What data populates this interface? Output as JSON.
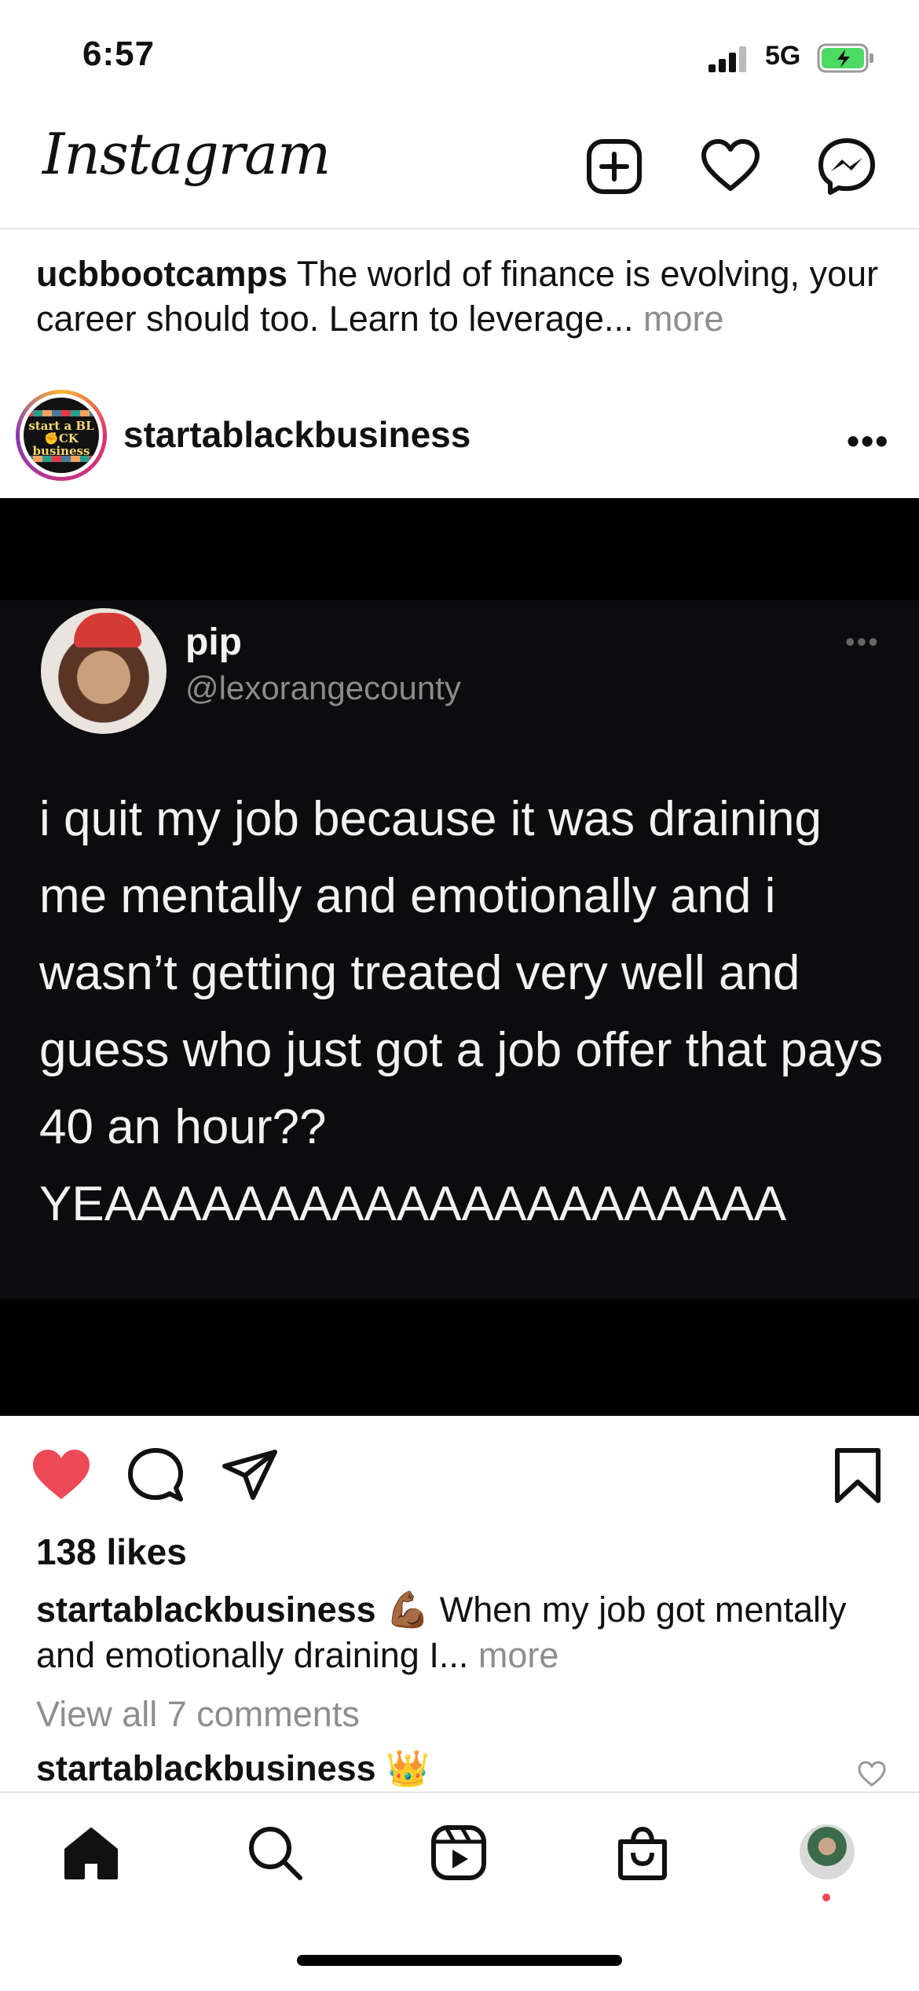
{
  "status_bar": {
    "time": "6:57",
    "network": "5G"
  },
  "header": {
    "logo": "Instagram"
  },
  "previous_post": {
    "username": "ucbbootcamps",
    "caption": " The world of finance is evolving, your career should too. Learn to leverage...",
    "more": " more"
  },
  "post": {
    "avatar_text": "start a BL✊CK business",
    "username": "startablackbusiness",
    "more": "•••",
    "tweet": {
      "name": "pip",
      "handle": "@lexorangecounty",
      "text": "i quit my job because it was draining me mentally and emotionally and i wasn’t getting treated very well and guess who just got a job offer that pays 40 an hour?? YEAAAAAAAAAAAAAAAAAAAAA"
    },
    "likes": "138 likes",
    "caption_user": "startablackbusiness",
    "caption_text": " 💪🏾 When my job got mentally and emotionally draining I...",
    "caption_more": " more",
    "view_comments": "View all 7 comments",
    "comment_user": "startablackbusiness",
    "comment_text": " 👑"
  },
  "colors": {
    "like_red": "#ed4956",
    "muted": "#8e8e8e"
  },
  "icons": [
    "new-post-icon",
    "heart-icon",
    "messenger-icon",
    "like-icon",
    "comment-icon",
    "share-icon",
    "bookmark-icon",
    "home-icon",
    "search-icon",
    "reels-icon",
    "shop-icon"
  ]
}
